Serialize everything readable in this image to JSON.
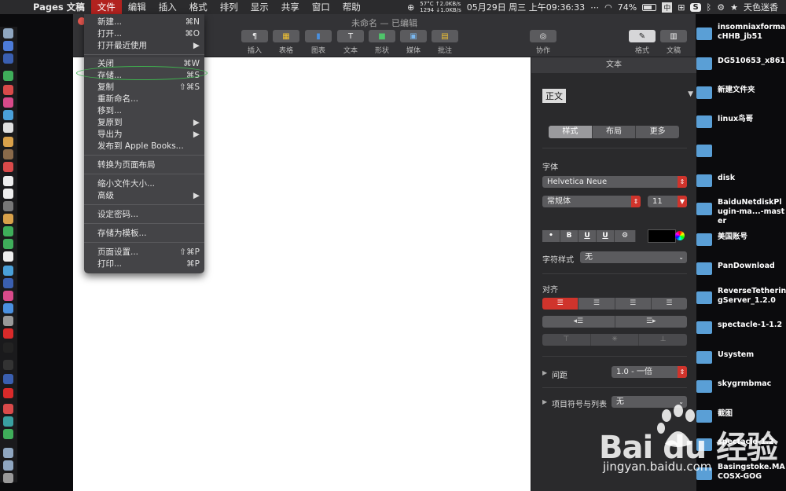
{
  "menubar": {
    "app": "Pages 文稿",
    "items": [
      "文件",
      "编辑",
      "插入",
      "格式",
      "排列",
      "显示",
      "共享",
      "窗口",
      "帮助"
    ],
    "stats": {
      "temp": "57°C",
      "fan": "1294",
      "up": "↑2.0KB/s",
      "down": "↓1.0KB/s"
    },
    "datetime": "05月29日 周三 上午09:36:33",
    "battery": "74%",
    "input_method": "中",
    "user": "天色迷香"
  },
  "window": {
    "title": "未命名 — 已编辑",
    "toolbar": [
      {
        "label": "插入",
        "icon": "¶"
      },
      {
        "label": "表格",
        "icon": "▦"
      },
      {
        "label": "图表",
        "icon": "▮"
      },
      {
        "label": "文本",
        "icon": "T"
      },
      {
        "label": "形状",
        "icon": "■"
      },
      {
        "label": "媒体",
        "icon": "▣"
      },
      {
        "label": "批注",
        "icon": "▤"
      },
      {
        "label": "协作",
        "icon": "◎"
      },
      {
        "label": "格式",
        "icon": "✎"
      },
      {
        "label": "文稿",
        "icon": "▥"
      }
    ]
  },
  "inspector": {
    "header": "文本",
    "paragraph_style": "正文",
    "tabs": [
      "样式",
      "布局",
      "更多"
    ],
    "font_section": "字体",
    "font_name": "Helvetica Neue",
    "font_style": "常规体",
    "font_size": "11",
    "format_buttons": [
      "•",
      "B",
      "U",
      "U",
      "⚙"
    ],
    "char_style_label": "字符样式",
    "char_style_value": "无",
    "align_section": "对齐",
    "spacing_label": "间距",
    "spacing_value": "1.0 - 一倍",
    "bullets_label": "项目符号与列表",
    "bullets_value": "无"
  },
  "file_menu": {
    "items": [
      {
        "label": "新建...",
        "shortcut": "⌘N"
      },
      {
        "label": "打开...",
        "shortcut": "⌘O"
      },
      {
        "label": "打开最近使用",
        "shortcut": "▶"
      },
      {
        "label": "关闭",
        "shortcut": "⌘W"
      },
      {
        "label": "存储...",
        "shortcut": "⌘S"
      },
      {
        "label": "复制",
        "shortcut": "⇧⌘S"
      },
      {
        "label": "重新命名...",
        "shortcut": ""
      },
      {
        "label": "移到...",
        "shortcut": ""
      },
      {
        "label": "复原到",
        "shortcut": "▶"
      },
      {
        "label": "导出为",
        "shortcut": "▶"
      },
      {
        "label": "发布到 Apple Books...",
        "shortcut": ""
      },
      {
        "label": "转换为页面布局",
        "shortcut": ""
      },
      {
        "label": "缩小文件大小...",
        "shortcut": ""
      },
      {
        "label": "高级",
        "shortcut": "▶"
      },
      {
        "label": "设定密码...",
        "shortcut": ""
      },
      {
        "label": "存储为模板...",
        "shortcut": ""
      },
      {
        "label": "页面设置...",
        "shortcut": "⇧⌘P"
      },
      {
        "label": "打印...",
        "shortcut": "⌘P"
      }
    ]
  },
  "desktop": [
    "insomniaxformacHHB_jb51",
    "DG510653_x861",
    "新建文件夹",
    "linux鸟哥",
    "",
    "disk",
    "BaiduNetdiskPlugin-ma...-master",
    "美国账号",
    "PanDownload",
    "ReverseTetheringServer_1.2.0",
    "spectacle-1-1.2",
    "Usystem",
    "skygrmbmac",
    "截图",
    "spectacle-1.2",
    "Basingstoke.MACOSX-GOG"
  ],
  "watermark": {
    "main": "Bai du 经验",
    "sub": "jingyan.baidu.com"
  },
  "colors": {
    "accent_red": "#d0342c",
    "menu_highlight": "#b2221f",
    "annotation_green": "#3fb34f",
    "folder_blue": "#5a9fd6"
  }
}
